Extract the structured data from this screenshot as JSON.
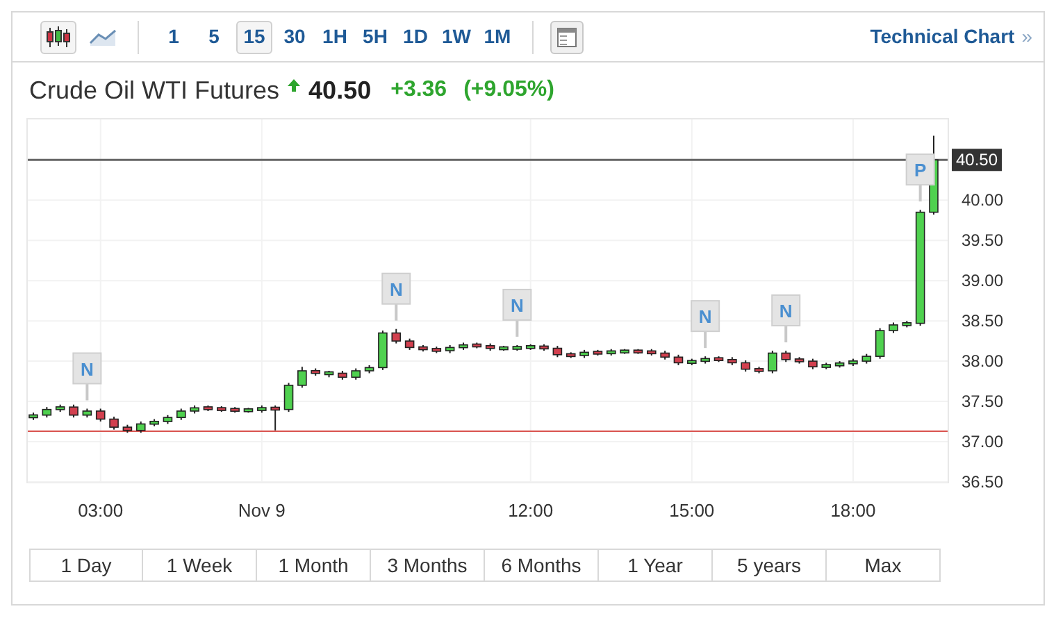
{
  "toolbar": {
    "chart_types": [
      {
        "kind": "candlestick",
        "selected": true
      },
      {
        "kind": "line",
        "selected": false
      }
    ],
    "intervals": [
      {
        "label": "1",
        "selected": false
      },
      {
        "label": "5",
        "selected": false
      },
      {
        "label": "15",
        "selected": true
      },
      {
        "label": "30",
        "selected": false
      },
      {
        "label": "1H",
        "selected": false
      },
      {
        "label": "5H",
        "selected": false
      },
      {
        "label": "1D",
        "selected": false
      },
      {
        "label": "1W",
        "selected": false
      },
      {
        "label": "1M",
        "selected": false
      }
    ],
    "link": "Technical Chart",
    "link_chevron": "»"
  },
  "quote": {
    "name": "Crude Oil WTI Futures",
    "price": "40.50",
    "change": "+3.36",
    "change_percent": "(+9.05%)"
  },
  "chart": {
    "markers": [
      "N",
      "N",
      "N",
      "N",
      "N",
      "P"
    ],
    "chart_data": {
      "type": "candlestick",
      "grid": true,
      "ylim": [
        36.5,
        41.02
      ],
      "yticks": [
        {
          "value": 36.5,
          "label": "36.50"
        },
        {
          "value": 37,
          "label": "37.00"
        },
        {
          "value": 37.5,
          "label": "37.50"
        },
        {
          "value": 38,
          "label": "38.00"
        },
        {
          "value": 38.5,
          "label": "38.50"
        },
        {
          "value": 39,
          "label": "39.00"
        },
        {
          "value": 39.5,
          "label": "39.50"
        },
        {
          "value": 40,
          "label": "40.00"
        }
      ],
      "ref_lines": [
        {
          "axis": "y",
          "value": 40.5,
          "label": "40.50",
          "color": "#666666"
        },
        {
          "axis": "y",
          "value": 37.13,
          "color": "#d9534f"
        }
      ],
      "categories": [
        null,
        null,
        null,
        null,
        null,
        "03:00",
        null,
        null,
        null,
        null,
        null,
        null,
        null,
        null,
        null,
        null,
        null,
        "Nov 9",
        null,
        null,
        null,
        null,
        null,
        null,
        null,
        null,
        null,
        null,
        null,
        null,
        null,
        null,
        null,
        null,
        null,
        null,
        null,
        "12:00",
        null,
        null,
        null,
        null,
        null,
        null,
        null,
        null,
        null,
        null,
        null,
        "15:00",
        null,
        null,
        null,
        null,
        null,
        null,
        null,
        null,
        null,
        null,
        null,
        "18:00",
        null,
        null,
        null,
        null,
        null,
        null
      ],
      "ohlc": [
        [
          37.3,
          37.36,
          37.27,
          37.33
        ],
        [
          37.33,
          37.43,
          37.3,
          37.4
        ],
        [
          37.4,
          37.46,
          37.37,
          37.43
        ],
        [
          37.43,
          37.46,
          37.3,
          37.33
        ],
        [
          37.33,
          37.41,
          37.3,
          37.38
        ],
        [
          37.38,
          37.41,
          37.25,
          37.28
        ],
        [
          37.28,
          37.31,
          37.15,
          37.18
        ],
        [
          37.18,
          37.21,
          37.11,
          37.14
        ],
        [
          37.14,
          37.25,
          37.11,
          37.22
        ],
        [
          37.22,
          37.28,
          37.19,
          37.25
        ],
        [
          37.25,
          37.33,
          37.22,
          37.3
        ],
        [
          37.3,
          37.41,
          37.27,
          37.38
        ],
        [
          37.38,
          37.45,
          37.35,
          37.42
        ],
        [
          37.42,
          37.45,
          37.38,
          37.41
        ],
        [
          37.41,
          37.44,
          37.37,
          37.4
        ],
        [
          37.4,
          37.43,
          37.36,
          37.39
        ],
        [
          37.38,
          37.42,
          37.36,
          37.4
        ],
        [
          37.39,
          37.45,
          37.36,
          37.42
        ],
        [
          37.42,
          37.45,
          37.14,
          37.4
        ],
        [
          37.4,
          37.73,
          37.37,
          37.7
        ],
        [
          37.7,
          37.93,
          37.67,
          37.88
        ],
        [
          37.88,
          37.91,
          37.82,
          37.85
        ],
        [
          37.84,
          37.88,
          37.8,
          37.86
        ],
        [
          37.85,
          37.88,
          37.77,
          37.8
        ],
        [
          37.8,
          37.91,
          37.77,
          37.88
        ],
        [
          37.88,
          37.95,
          37.85,
          37.92
        ],
        [
          37.92,
          38.38,
          37.89,
          38.35
        ],
        [
          38.35,
          38.4,
          38.22,
          38.25
        ],
        [
          38.25,
          38.28,
          38.14,
          38.17
        ],
        [
          38.17,
          38.2,
          38.12,
          38.15
        ],
        [
          38.15,
          38.18,
          38.1,
          38.13
        ],
        [
          38.13,
          38.2,
          38.1,
          38.17
        ],
        [
          38.17,
          38.23,
          38.14,
          38.2
        ],
        [
          38.2,
          38.23,
          38.16,
          38.19
        ],
        [
          38.19,
          38.22,
          38.13,
          38.16
        ],
        [
          38.15,
          38.19,
          38.13,
          38.17
        ],
        [
          38.16,
          38.2,
          38.13,
          38.17
        ],
        [
          38.17,
          38.21,
          38.14,
          38.18
        ],
        [
          38.18,
          38.21,
          38.13,
          38.16
        ],
        [
          38.16,
          38.19,
          38.05,
          38.08
        ],
        [
          38.08,
          38.11,
          38.04,
          38.07
        ],
        [
          38.07,
          38.14,
          38.04,
          38.11
        ],
        [
          38.11,
          38.14,
          38.07,
          38.1
        ],
        [
          38.1,
          38.15,
          38.07,
          38.12
        ],
        [
          38.11,
          38.15,
          38.09,
          38.13
        ],
        [
          38.13,
          38.15,
          38.09,
          38.11
        ],
        [
          38.12,
          38.15,
          38.07,
          38.1
        ],
        [
          38.1,
          38.13,
          38.02,
          38.05
        ],
        [
          38.05,
          38.08,
          37.95,
          37.98
        ],
        [
          37.98,
          38.03,
          37.95,
          38.0
        ],
        [
          38.0,
          38.06,
          37.97,
          38.03
        ],
        [
          38.03,
          38.06,
          37.99,
          38.02
        ],
        [
          38.02,
          38.05,
          37.95,
          37.98
        ],
        [
          37.98,
          38.01,
          37.87,
          37.9
        ],
        [
          37.9,
          37.93,
          37.85,
          37.88
        ],
        [
          37.88,
          38.13,
          37.85,
          38.1
        ],
        [
          38.1,
          38.13,
          37.99,
          38.02
        ],
        [
          38.02,
          38.05,
          37.97,
          38.0
        ],
        [
          38.0,
          38.03,
          37.9,
          37.93
        ],
        [
          37.93,
          37.98,
          37.9,
          37.95
        ],
        [
          37.95,
          38.0,
          37.92,
          37.97
        ],
        [
          37.97,
          38.03,
          37.94,
          38.0
        ],
        [
          38.0,
          38.09,
          37.97,
          38.06
        ],
        [
          38.06,
          38.41,
          38.03,
          38.38
        ],
        [
          38.38,
          38.48,
          38.35,
          38.45
        ],
        [
          38.45,
          38.5,
          38.42,
          38.47
        ],
        [
          38.47,
          39.88,
          38.44,
          39.85
        ],
        [
          39.85,
          40.8,
          39.82,
          40.5
        ]
      ]
    }
  },
  "ranges": [
    {
      "label": "1 Day"
    },
    {
      "label": "1 Week"
    },
    {
      "label": "1 Month"
    },
    {
      "label": "3 Months"
    },
    {
      "label": "6 Months"
    },
    {
      "label": "1 Year"
    },
    {
      "label": "5 years"
    },
    {
      "label": "Max"
    }
  ]
}
